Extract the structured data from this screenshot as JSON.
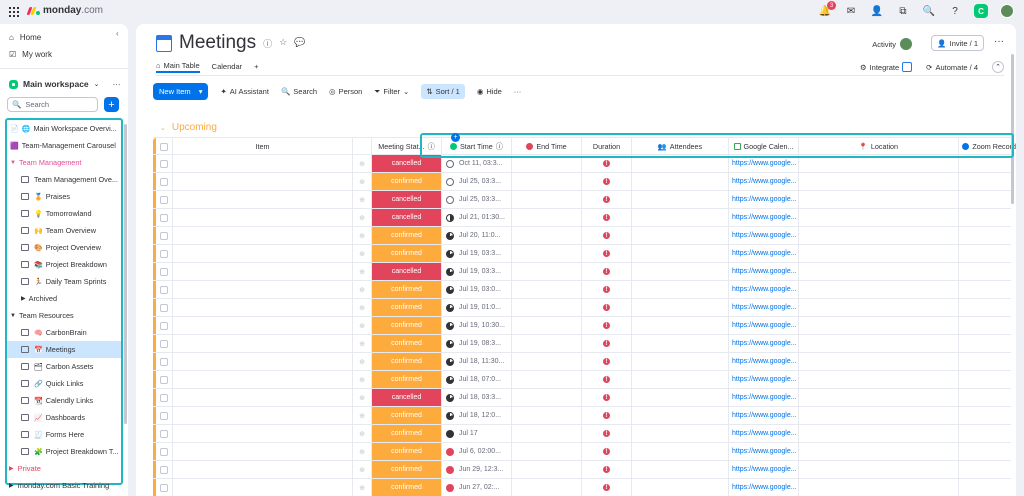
{
  "app": {
    "logo_bold": "monday",
    "logo_suffix": ".com",
    "notification_count": "3"
  },
  "sidebar": {
    "home": "Home",
    "my_work": "My work",
    "workspace": "Main workspace",
    "search_placeholder": "Search",
    "add_label": "+",
    "items": [
      {
        "label": "Main Workspace Overvi...",
        "type": "doc",
        "indent": 0,
        "emoji": "🌐"
      },
      {
        "label": "Team-Management Carousel",
        "type": "app",
        "indent": 0,
        "emoji": ""
      },
      {
        "label": "Team Management",
        "type": "folder-pink",
        "indent": 0,
        "emoji": ""
      },
      {
        "label": "Team Management Ove...",
        "type": "board",
        "indent": 1,
        "emoji": ""
      },
      {
        "label": "Praises",
        "type": "board",
        "indent": 1,
        "emoji": "🏅"
      },
      {
        "label": "Tomorrowland",
        "type": "board",
        "indent": 1,
        "emoji": "💡"
      },
      {
        "label": "Team Overview",
        "type": "board",
        "indent": 1,
        "emoji": "🙌"
      },
      {
        "label": "Project Overview",
        "type": "board",
        "indent": 1,
        "emoji": "🎨"
      },
      {
        "label": "Project Breakdown",
        "type": "board",
        "indent": 1,
        "emoji": "📚"
      },
      {
        "label": "Daily Team Sprints",
        "type": "board",
        "indent": 1,
        "emoji": "🏃"
      },
      {
        "label": "Archived",
        "type": "subfolder",
        "indent": 1,
        "emoji": ""
      },
      {
        "label": "Team Resources",
        "type": "folder",
        "indent": 0,
        "emoji": ""
      },
      {
        "label": "CarbonBrain",
        "type": "board",
        "indent": 1,
        "emoji": "🧠"
      },
      {
        "label": "Meetings",
        "type": "board-active",
        "indent": 1,
        "emoji": "📅"
      },
      {
        "label": "Carbon Assets",
        "type": "board",
        "indent": 1,
        "emoji": "🗂"
      },
      {
        "label": "Quick Links",
        "type": "board",
        "indent": 1,
        "emoji": "🔗"
      },
      {
        "label": "Calendly Links",
        "type": "board",
        "indent": 1,
        "emoji": "📆"
      },
      {
        "label": "Dashboards",
        "type": "board",
        "indent": 1,
        "emoji": "📈"
      },
      {
        "label": "Forms Here",
        "type": "board",
        "indent": 1,
        "emoji": "🧾"
      },
      {
        "label": "Project Breakdown T...",
        "type": "board",
        "indent": 1,
        "emoji": "🧩"
      }
    ],
    "private": "Private",
    "training": "monday.com Basic Training"
  },
  "board": {
    "title": "Meetings",
    "activity": "Activity",
    "invite": "Invite / 1",
    "tabs": [
      "Main Table",
      "Calendar"
    ],
    "tab_add": "+",
    "integrate": "Integrate",
    "automate": "Automate / 4",
    "toolbar": {
      "new_item": "New Item",
      "ai": "AI Assistant",
      "search": "Search",
      "person": "Person",
      "filter": "Filter",
      "sort": "Sort / 1",
      "hide": "Hide"
    },
    "group": "Upcoming",
    "columns": {
      "item": "Item",
      "status": "Meeting Stat...",
      "start": "Start Time",
      "end": "End Time",
      "duration": "Duration",
      "attendees": "Attendees",
      "gcal": "Google Calen...",
      "location": "Location",
      "zoom": "Zoom Recording"
    },
    "status_colors": {
      "cancelled": "#e2445c",
      "confirmed": "#fdab3d"
    },
    "rows": [
      {
        "status": "cancelled",
        "start": "Oct 11, 03:3...",
        "ring": "empty",
        "link": "https://www.google..."
      },
      {
        "status": "confirmed",
        "start": "Jul 25, 03:3...",
        "ring": "empty",
        "link": "https://www.google..."
      },
      {
        "status": "cancelled",
        "start": "Jul 25, 03:3...",
        "ring": "empty",
        "link": "https://www.google..."
      },
      {
        "status": "cancelled",
        "start": "Jul 21, 01:30...",
        "ring": "half",
        "link": "https://www.google..."
      },
      {
        "status": "confirmed",
        "start": "Jul 20, 11:0...",
        "ring": "most",
        "link": "https://www.google..."
      },
      {
        "status": "confirmed",
        "start": "Jul 19, 03:3...",
        "ring": "most",
        "link": "https://www.google..."
      },
      {
        "status": "cancelled",
        "start": "Jul 19, 03:3...",
        "ring": "most",
        "link": "https://www.google..."
      },
      {
        "status": "confirmed",
        "start": "Jul 19, 03:0...",
        "ring": "most",
        "link": "https://www.google..."
      },
      {
        "status": "confirmed",
        "start": "Jul 19, 01:0...",
        "ring": "most",
        "link": "https://www.google..."
      },
      {
        "status": "confirmed",
        "start": "Jul 19, 10:30...",
        "ring": "most",
        "link": "https://www.google..."
      },
      {
        "status": "confirmed",
        "start": "Jul 19, 08:3...",
        "ring": "most",
        "link": "https://www.google..."
      },
      {
        "status": "confirmed",
        "start": "Jul 18, 11:30...",
        "ring": "most",
        "link": "https://www.google..."
      },
      {
        "status": "confirmed",
        "start": "Jul 18, 07:0...",
        "ring": "most",
        "link": "https://www.google..."
      },
      {
        "status": "cancelled",
        "start": "Jul 18, 03:3...",
        "ring": "most",
        "link": "https://www.google..."
      },
      {
        "status": "confirmed",
        "start": "Jul 18, 12:0...",
        "ring": "most",
        "link": "https://www.google..."
      },
      {
        "status": "confirmed",
        "start": "Jul 17",
        "ring": "full",
        "link": "https://www.google..."
      },
      {
        "status": "confirmed",
        "start": "Jul 6, 02:00...",
        "ring": "overdue",
        "link": "https://www.google..."
      },
      {
        "status": "confirmed",
        "start": "Jun 29, 12:3...",
        "ring": "overdue",
        "link": "https://www.google..."
      },
      {
        "status": "confirmed",
        "start": "Jun 27, 02:...",
        "ring": "overdue",
        "link": "https://www.google..."
      }
    ]
  }
}
